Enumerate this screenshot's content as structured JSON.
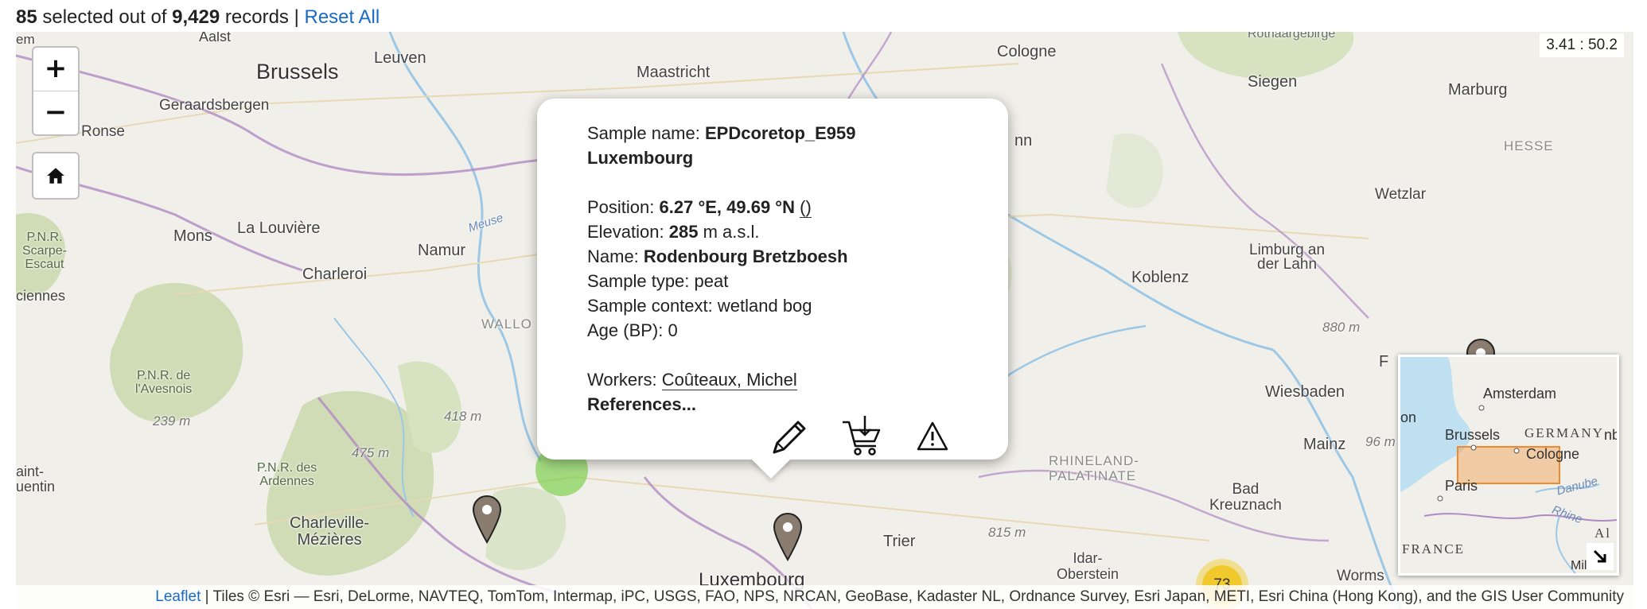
{
  "header": {
    "selected_count": "85",
    "selected_text": "selected out of",
    "total_count": "9,429",
    "records_text": "records |",
    "reset_label": "Reset All"
  },
  "map": {
    "coordinates": "3.41 : 50.2",
    "zoom_in": "+",
    "zoom_out": "−",
    "labels": {
      "aalst": "Aalst",
      "brussels": "Brussels",
      "leuven": "Leuven",
      "maastricht": "Maastricht",
      "cologne": "Cologne",
      "rothaargebirge": "Rothaargebirge",
      "siegen": "Siegen",
      "marburg": "Marburg",
      "hesse": "HESSE",
      "geraardsbergen": "Geraardsbergen",
      "ronse": "Ronse",
      "wetzlar": "Wetzlar",
      "mons": "Mons",
      "la_louviere": "La Louvière",
      "namur": "Namur",
      "meuse": "Meuse",
      "pnr_scarpe": "P.N.R.\nScarpe-\nEscaut",
      "charleroi": "Charleroi",
      "ciennes": "ciennes",
      "wallo": "WALLO",
      "koblenz": "Koblenz",
      "limburg": "Limburg an\nder Lahn",
      "elev_880": "880 m",
      "pnr_avesnois": "P.N.R. de\nl'Avesnois",
      "elev_239": "239 m",
      "elev_418": "418 m",
      "elev_475": "475 m",
      "pnr_ardennes": "P.N.R. des\nArdennes",
      "saint_quentin": "aint-\nuentin",
      "charleville": "Charleville-\nMézières",
      "rhineland": "RHINELAND-\nPALATINATE",
      "wiesbaden": "Wiesbaden",
      "mainz": "Mainz",
      "elev_96": "96 m",
      "bad_kreuznach": "Bad\nKreuznach",
      "trier": "Trier",
      "elev_815": "815 m",
      "idar": "Idar-\nOberstein",
      "luxembourg": "Luxembourg",
      "worms": "Worms",
      "em": "em",
      "nn": "nn",
      "f": "F"
    },
    "cluster_count": "73"
  },
  "minimap": {
    "amsterdam": "Amsterdam",
    "brussels": "Brussels",
    "germany": "GERMANY",
    "cologne": "Cologne",
    "paris": "Paris",
    "danube": "Danube",
    "rhine": "Rhine",
    "france": "FRANCE",
    "on": "on",
    "nb": "nb",
    "al": "Al",
    "mila": "Mila"
  },
  "popup": {
    "sample_label": "Sample name:",
    "sample_name": "EPDcoretop_E959",
    "country": "Luxembourg",
    "position_label": "Position:",
    "position_value": "6.27 °E, 49.69 °N",
    "position_suffix": "()",
    "elevation_label": "Elevation:",
    "elevation_value": "285",
    "elevation_unit": "m a.s.l.",
    "name_label": "Name:",
    "name_value": "Rodenbourg Bretzboesh",
    "type_label": "Sample type:",
    "type_value": "peat",
    "context_label": "Sample context:",
    "context_value": "wetland bog",
    "age_label": "Age (BP):",
    "age_value": "0",
    "workers_label": "Workers:",
    "workers_value": "Coûteaux, Michel",
    "references": "References..."
  },
  "attribution": {
    "leaflet": "Leaflet",
    "text": "| Tiles © Esri — Esri, DeLorme, NAVTEQ, TomTom, Intermap, iPC, USGS, FAO, NPS, NRCAN, GeoBase, Kadaster NL, Ordnance Survey, Esri Japan, METI, Esri China (Hong Kong), and the GIS User Community"
  },
  "colors": {
    "link": "#1a6bc5",
    "map_land": "#f1efe9",
    "forest": "#cfdcb6",
    "border": "#b189c3",
    "river": "#9cc8e6",
    "cluster_yellow": "#f0c20c",
    "cluster_green": "#6ecc39",
    "minimap_extent": "#f0a050"
  },
  "icons": {
    "zoom_in": "plus-icon",
    "zoom_out": "minus-icon",
    "home": "home-icon",
    "edit": "pencil-icon",
    "cart": "cart-download-icon",
    "warning": "warning-icon",
    "marker": "map-pin-icon",
    "minimap_toggle": "arrow-expand-icon"
  }
}
